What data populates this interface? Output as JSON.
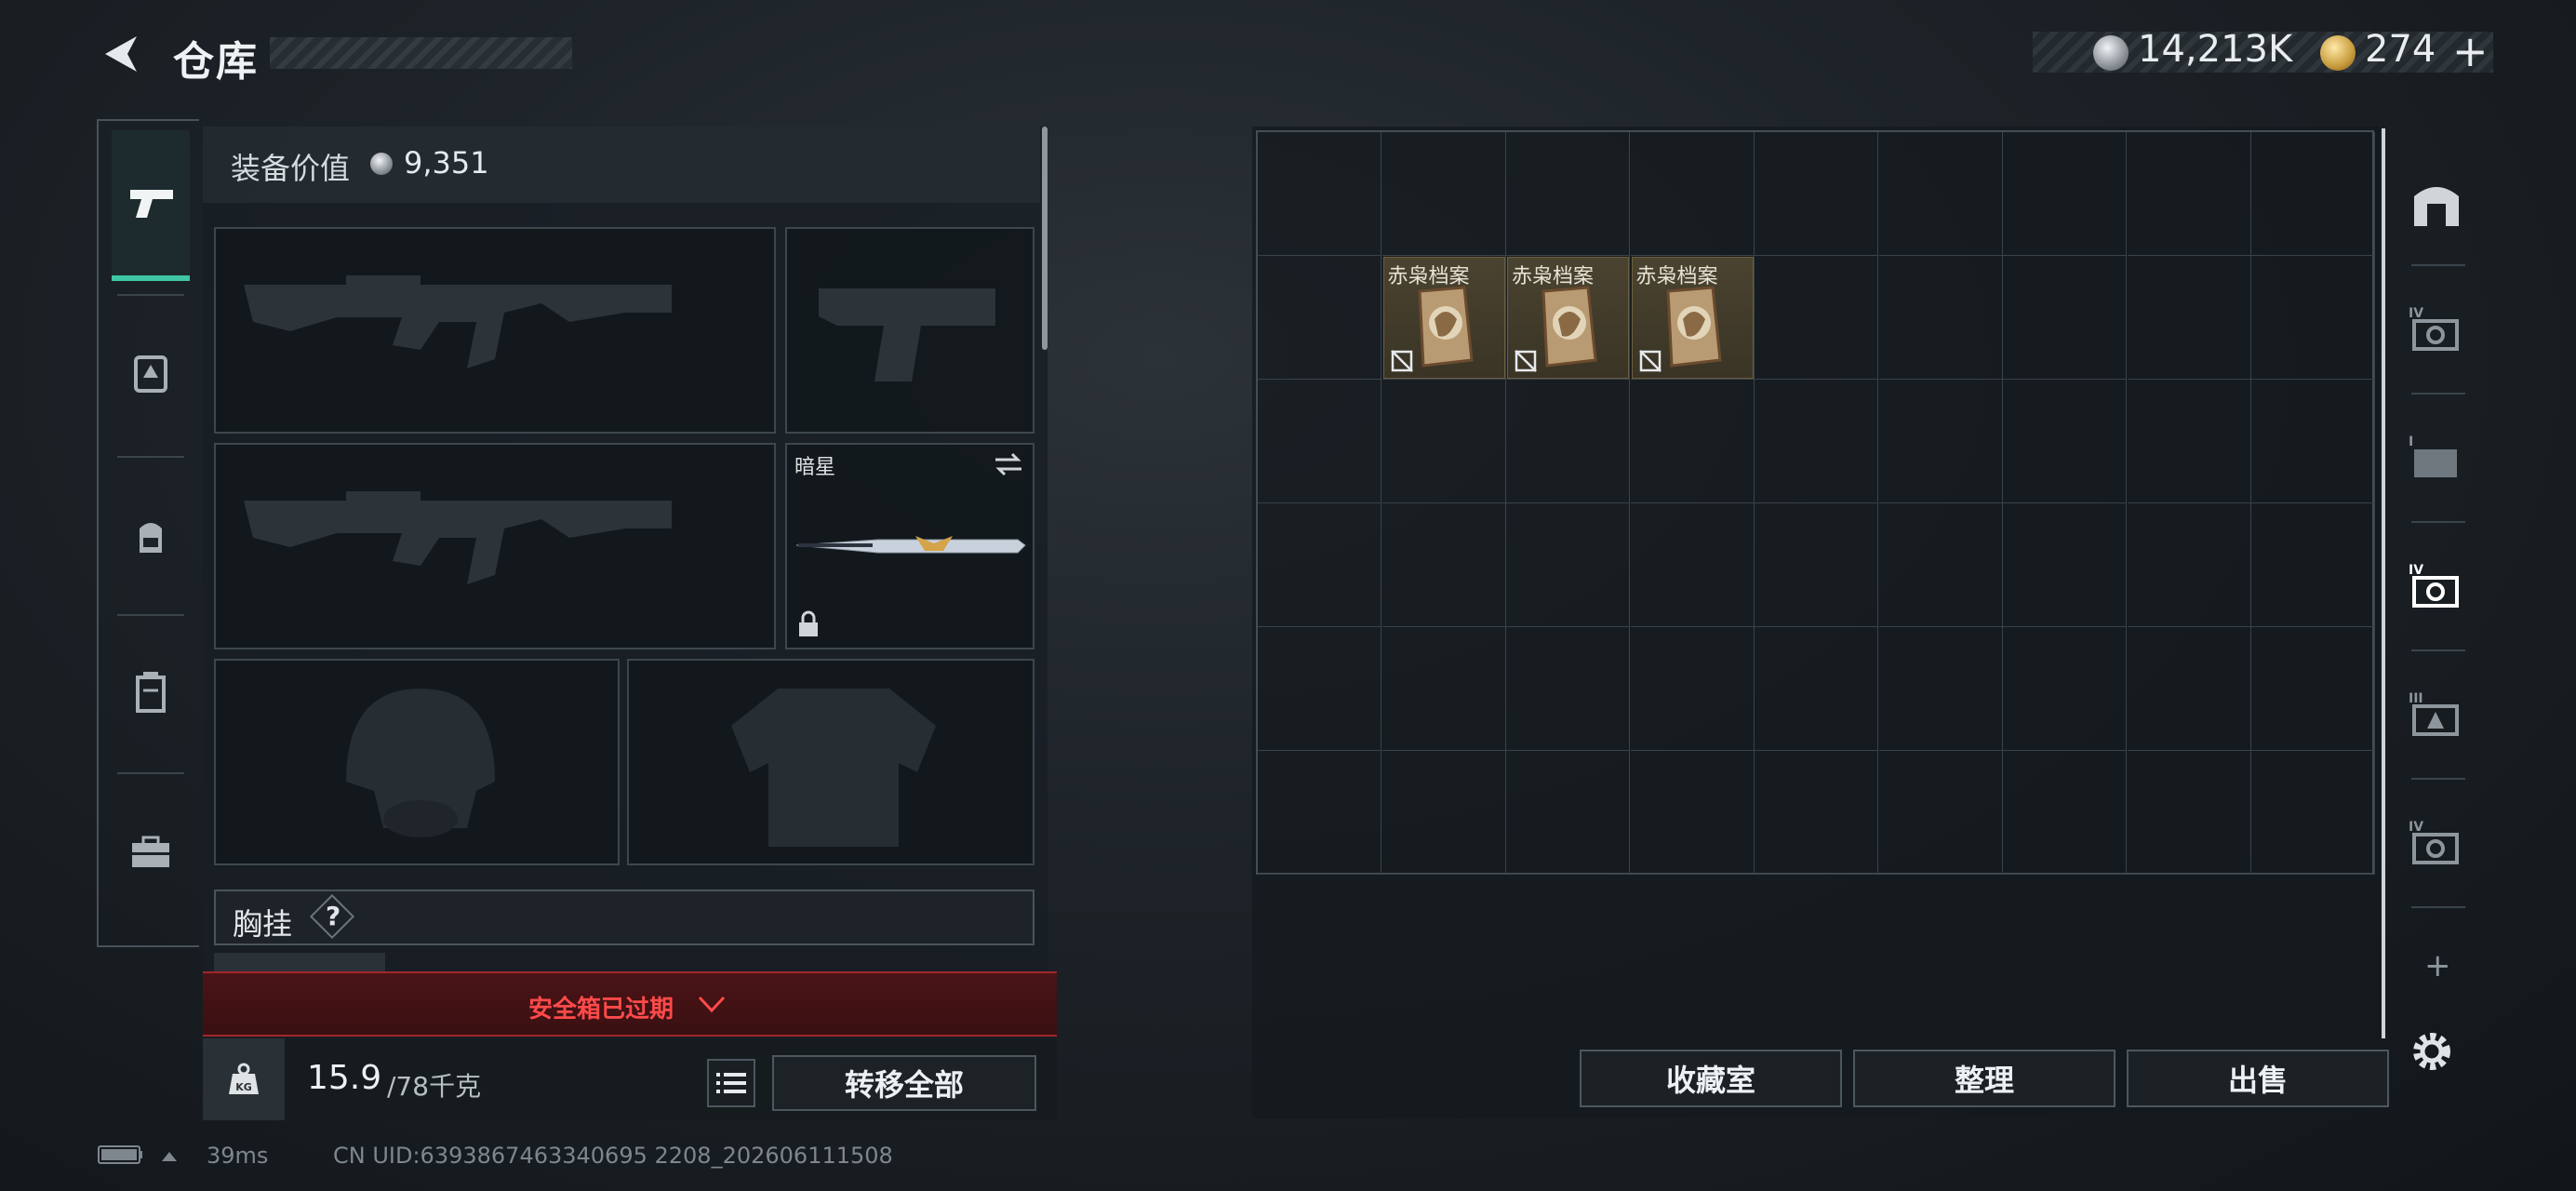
{
  "header": {
    "title": "仓库",
    "silver_amount": "14,213K",
    "gold_amount": "274",
    "add_label": "+"
  },
  "left_rail": {
    "tabs": [
      "pistol-icon",
      "backpack-rig-icon",
      "backpack-icon",
      "case-icon",
      "toolbox-icon"
    ],
    "selected": "pistol-icon",
    "accent_color": "#3fc7a5"
  },
  "equipment": {
    "value_label": "装备价值",
    "value_amount": "9,351",
    "melee_name": "暗星",
    "chest_rig_label": "胸挂",
    "chest_rig_help": "?",
    "safebox_message": "安全箱已过期",
    "weight_current": "15.9",
    "weight_max": "/78千克",
    "weight_icon_text": "KG",
    "transfer_all_label": "转移全部"
  },
  "stash": {
    "items": [
      {
        "name": "赤枭档案"
      },
      {
        "name": "赤枭档案"
      },
      {
        "name": "赤枭档案"
      }
    ],
    "buttons": {
      "collection": "收藏室",
      "sort": "整理",
      "sell": "出售"
    },
    "right_rail_icons": [
      "safe-icon",
      "tier-4-case-icon",
      "tier-1-case-icon",
      "tier-4-case-selected-icon",
      "tier-3-case-icon",
      "tier-4-case-icon-2"
    ],
    "right_rail_add": "+"
  },
  "status": {
    "ping": "39ms",
    "uid": "CN UID:6393867463340695 2208_202606111508"
  }
}
